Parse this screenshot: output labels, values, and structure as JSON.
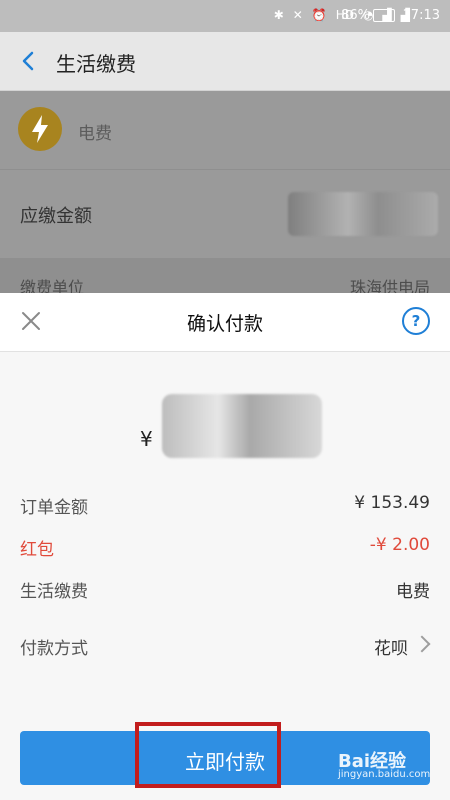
{
  "status_bar": {
    "icons": [
      "bluetooth-icon",
      "mute-icon",
      "alarm-icon",
      "hd-icon",
      "wifi-icon",
      "signal-4g-icon",
      "signal-3g-icon",
      "battery-icon"
    ],
    "battery_pct": "86%",
    "time": "17:13"
  },
  "header": {
    "title": "生活缴费"
  },
  "background": {
    "bill_name": "电费",
    "due_label": "应缴金额",
    "unit_label": "缴费单位",
    "unit_value": "珠海供电局"
  },
  "sheet": {
    "title": "确认付款",
    "currency": "¥",
    "rows": [
      {
        "label": "订单金额",
        "value": "¥ 153.49"
      },
      {
        "label": "红包",
        "value": "-¥ 2.00"
      },
      {
        "label": "生活缴费",
        "value": "电费"
      },
      {
        "label": "付款方式",
        "value": "花呗"
      }
    ]
  },
  "pay_button": {
    "label": "立即付款"
  },
  "watermark": {
    "logo": "Bai经验",
    "sub": "jingyan.baidu.com"
  },
  "colors": {
    "accent": "#2f8fe3",
    "red": "#e04a3b",
    "highlight": "#c21d1d",
    "elec_icon": "#a8841f"
  }
}
